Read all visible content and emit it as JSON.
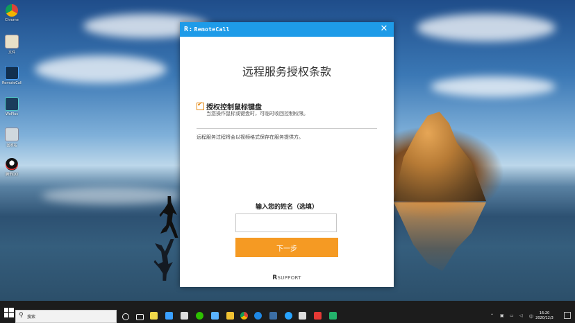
{
  "window": {
    "brand": "RemoteCall",
    "brand_mark": "R:",
    "close_glyph": "✕",
    "title": "远程服务授权条款",
    "checkbox_label": "授权控制鼠标键盘",
    "checkbox_checked": true,
    "checkbox_desc": "当您操作鼠标或键盘时，可临时收回控制权限。",
    "notice": "远程服务过程将会以视频格式保存在服务提供方。",
    "name_label": "输入您的姓名（选填）",
    "name_value": "",
    "next_label": "下一步",
    "footer_logo": "SUPPORT",
    "footer_logo_mark": "R"
  },
  "desktop": {
    "icons": [
      "Chrome",
      "文件",
      "RemoteCall",
      "WePlus",
      "回收站",
      "腾讯QQ"
    ]
  },
  "taskbar": {
    "search_placeholder": "搜索",
    "clock_time": "16:20",
    "clock_date": "2020/12/3"
  },
  "colors": {
    "titlebar": "#1e9be8",
    "accent_button": "#f59a23",
    "checkbox": "#e48a17"
  }
}
